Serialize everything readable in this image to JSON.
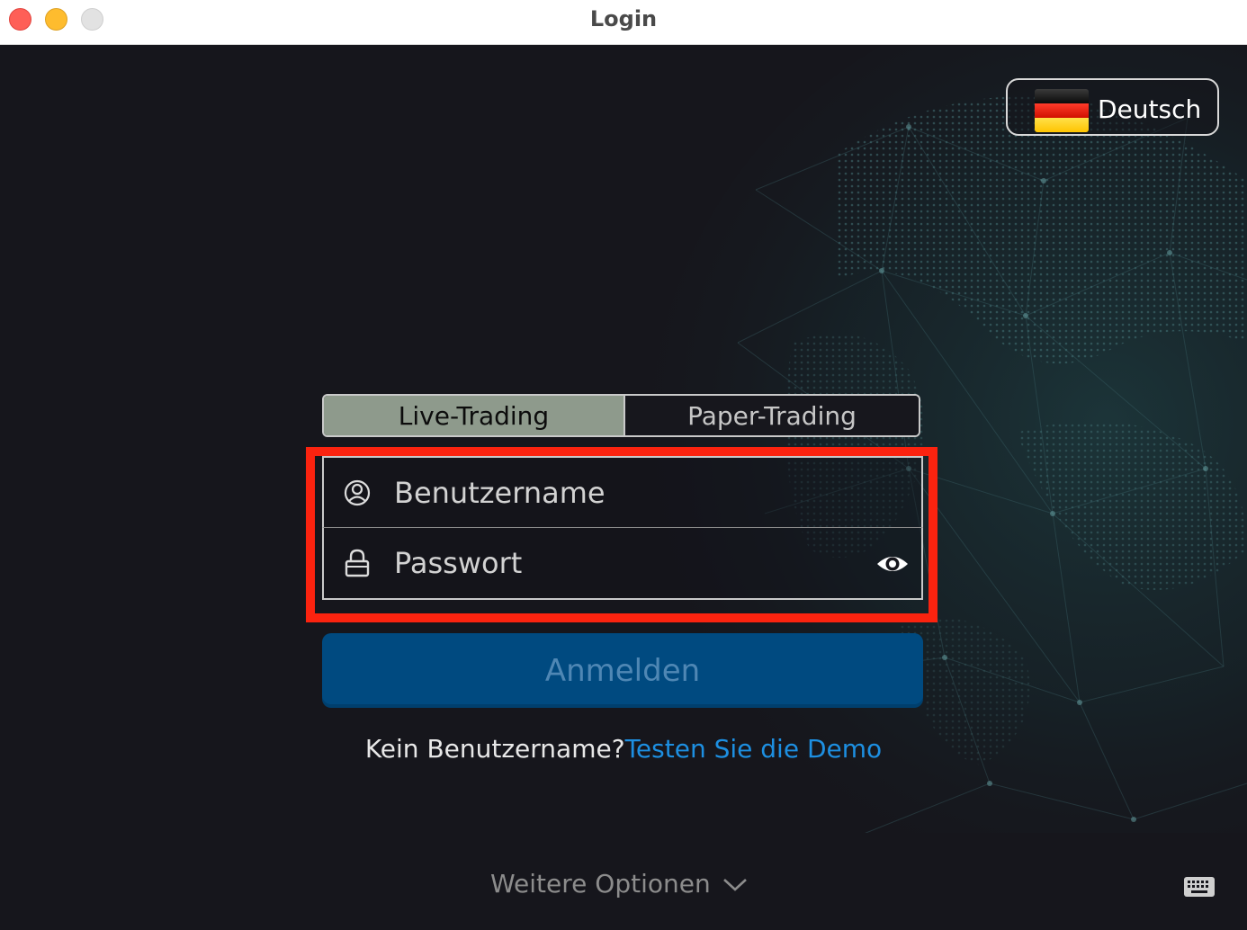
{
  "window": {
    "title": "Login"
  },
  "language": {
    "label": "Deutsch",
    "flag": "germany-flag-icon"
  },
  "tabs": {
    "live": "Live-Trading",
    "paper": "Paper-Trading",
    "active": "live"
  },
  "form": {
    "username_placeholder": "Benutzername",
    "password_placeholder": "Passwort"
  },
  "login_button": "Anmelden",
  "demo": {
    "prompt": "Kein Benutzername?",
    "link": "Testen Sie die Demo"
  },
  "more_options": "Weitere Optionen",
  "colors": {
    "background": "#16161c",
    "active_tab": "#8e9a8c",
    "login_button": "#004a80",
    "link": "#1d8fe1",
    "highlight": "#fb230f"
  }
}
